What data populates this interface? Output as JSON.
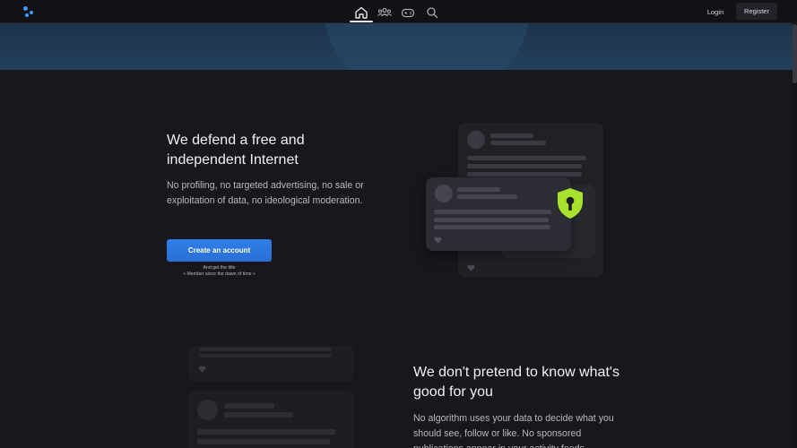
{
  "nav": {
    "login_label": "Login",
    "register_label": "Register",
    "icons": [
      "home-icon",
      "groups-icon",
      "gamepad-icon",
      "search-icon"
    ],
    "active_icon": "home-icon"
  },
  "colors": {
    "accent": "#2f7fe8",
    "banner": "#1d3349",
    "background": "#17171c",
    "shield": "#a6e22e"
  },
  "section1": {
    "title": "We defend a free and independent Internet",
    "body": "No profiling, no targeted advertising, no sale or exploitation of data, no ideological moderation.",
    "cta_label": "Create an account",
    "cta_note_line1": "And get the title",
    "cta_note_line2": "« Member since the dawn of time »"
  },
  "section2": {
    "title": "We don't pretend to know what's good for you",
    "body": "No algorithm uses your data to decide what you should see, follow or like. No sponsored publications appear in your activity feeds."
  }
}
